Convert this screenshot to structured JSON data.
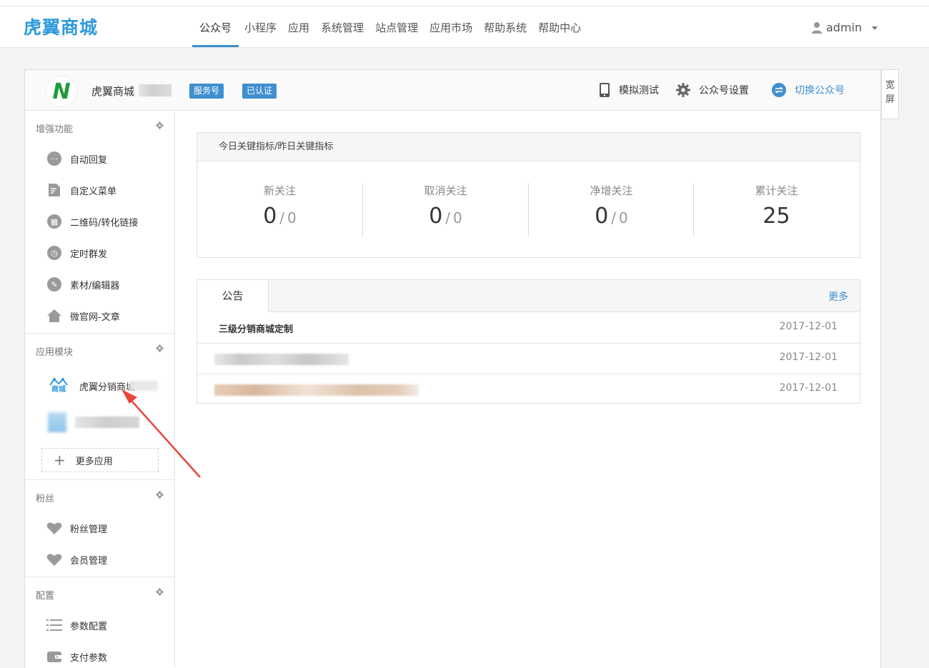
{
  "header": {
    "logo": "虎翼商城",
    "nav": [
      "公众号",
      "小程序",
      "应用",
      "系统管理",
      "站点管理",
      "应用市场",
      "帮助系统",
      "帮助中心"
    ],
    "active_nav": 0,
    "user": "admin"
  },
  "account": {
    "name": "虎翼商城",
    "logo_letter": "N",
    "badges": [
      "服务号",
      "已认证"
    ],
    "actions": {
      "simulate": "模拟测试",
      "settings": "公众号设置",
      "switch": "切换公众号"
    },
    "wide_screen": "宽\n屏"
  },
  "sidebar": {
    "sections": [
      {
        "title": "增强功能",
        "items": [
          "自动回复",
          "自定义菜单",
          "二维码/转化链接",
          "定时群发",
          "素材/编辑器",
          "微官网-文章"
        ]
      },
      {
        "title": "应用模块",
        "items": [
          "虎翼分销商城"
        ],
        "more": "更多应用"
      },
      {
        "title": "粉丝",
        "items": [
          "粉丝管理",
          "会员管理"
        ]
      },
      {
        "title": "配置",
        "items": [
          "参数配置",
          "支付参数"
        ]
      }
    ],
    "app_icon_text": "商城"
  },
  "stats": {
    "title": "今日关键指标/昨日关键指标",
    "items": [
      {
        "label": "新关注",
        "today": "0",
        "yesterday": "0"
      },
      {
        "label": "取消关注",
        "today": "0",
        "yesterday": "0"
      },
      {
        "label": "净增关注",
        "today": "0",
        "yesterday": "0"
      },
      {
        "label": "累计关注",
        "total": "25"
      }
    ],
    "separator": "/"
  },
  "notice": {
    "tab": "公告",
    "more": "更多",
    "rows": [
      {
        "title": "三级分销商城定制",
        "date": "2017-12-01"
      },
      {
        "title": "",
        "date": "2017-12-01"
      },
      {
        "title": "",
        "date": "2017-12-01"
      }
    ]
  },
  "colors": {
    "accent": "#3f8fcf",
    "logo": "#2e9bdc",
    "arrow": "#e8453c"
  }
}
